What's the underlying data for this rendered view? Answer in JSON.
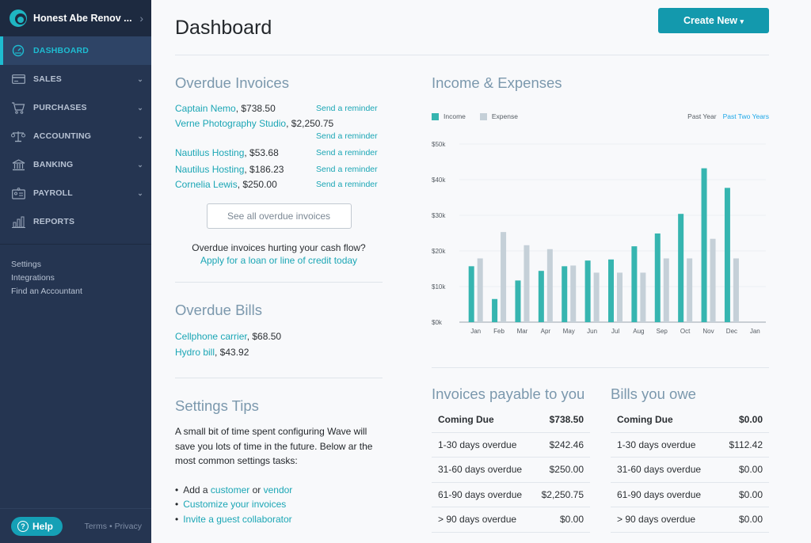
{
  "sidebar": {
    "business_name": "Honest Abe Renov ...",
    "nav": [
      {
        "label": "DASHBOARD",
        "icon": "dashboard-gauge-icon",
        "active": true,
        "expandable": false
      },
      {
        "label": "SALES",
        "icon": "credit-card-icon",
        "active": false,
        "expandable": true
      },
      {
        "label": "PURCHASES",
        "icon": "shopping-cart-icon",
        "active": false,
        "expandable": true
      },
      {
        "label": "ACCOUNTING",
        "icon": "scales-icon",
        "active": false,
        "expandable": true
      },
      {
        "label": "BANKING",
        "icon": "bank-icon",
        "active": false,
        "expandable": true
      },
      {
        "label": "PAYROLL",
        "icon": "id-badge-icon",
        "active": false,
        "expandable": true
      },
      {
        "label": "REPORTS",
        "icon": "bar-chart-icon",
        "active": false,
        "expandable": false
      }
    ],
    "links": [
      "Settings",
      "Integrations",
      "Find an Accountant"
    ],
    "help_label": "Help",
    "terms_label": "Terms",
    "separator": "•",
    "privacy_label": "Privacy"
  },
  "header": {
    "title": "Dashboard",
    "create_label": "Create New",
    "create_caret": "▾"
  },
  "overdue_invoices": {
    "title": "Overdue Invoices",
    "items": [
      {
        "name": "Captain Nemo",
        "amount": ", $738.50",
        "action": "Send a reminder"
      },
      {
        "name": "Verne Photography Studio",
        "amount": ", $2,250.75",
        "action": "Send a reminder"
      },
      {
        "name": "Nautilus Hosting",
        "amount": ", $53.68",
        "action": "Send a reminder"
      },
      {
        "name": "Nautilus Hosting",
        "amount": ", $186.23",
        "action": "Send a reminder"
      },
      {
        "name": "Cornelia Lewis",
        "amount": ", $250.00",
        "action": "Send a reminder"
      }
    ],
    "see_all_label": "See all overdue invoices",
    "cash_flow_text": "Overdue invoices hurting your cash flow?",
    "loan_link": "Apply for a loan or line of credit today"
  },
  "overdue_bills": {
    "title": "Overdue Bills",
    "items": [
      {
        "name": "Cellphone carrier",
        "amount": ", $68.50"
      },
      {
        "name": "Hydro bill",
        "amount": ", $43.92"
      }
    ]
  },
  "settings_tips": {
    "title": "Settings Tips",
    "text": "A small bit of time spent configuring Wave will save you lots of time in the future. Below ar the most common settings tasks:",
    "add_prefix": "Add a ",
    "customer_link": "customer",
    "or_text": " or ",
    "vendor_link": "vendor",
    "customize_link": "Customize your invoices",
    "invite_link": "Invite a guest collaborator"
  },
  "income_expenses": {
    "title": "Income & Expenses",
    "periods": [
      {
        "label": "Past Year",
        "selected": false
      },
      {
        "label": "Past Two Years",
        "selected": true
      }
    ]
  },
  "colors": {
    "income": "#36b5b0",
    "expense": "#c5d0d8",
    "accent": "#1399ad",
    "sidebar": "#253551"
  },
  "chart_data": {
    "type": "bar",
    "title": "Income & Expenses",
    "xlabel": "",
    "ylabel": "",
    "categories": [
      "Jan",
      "Feb",
      "Mar",
      "Apr",
      "May",
      "Jun",
      "Jul",
      "Aug",
      "Sep",
      "Oct",
      "Nov",
      "Dec",
      "Jan"
    ],
    "series": [
      {
        "name": "Income",
        "values": [
          15.7,
          6.5,
          11.7,
          14.4,
          15.7,
          17.3,
          17.6,
          21.3,
          24.9,
          30.4,
          43.2,
          37.7,
          null
        ]
      },
      {
        "name": "Expense",
        "values": [
          17.9,
          25.3,
          21.6,
          20.5,
          15.9,
          13.9,
          13.9,
          13.9,
          17.9,
          17.9,
          23.4,
          17.9,
          null
        ]
      }
    ],
    "units": "thousands USD",
    "ylim": [
      0,
      50
    ],
    "yticks": [
      0,
      10,
      20,
      30,
      40,
      50
    ],
    "ytick_labels": [
      "$0k",
      "$10k",
      "$20k",
      "$30k",
      "$40k",
      "$50k"
    ],
    "grid": true,
    "legend": "top-left"
  },
  "invoices_payable": {
    "title": "Invoices payable to you",
    "rows": [
      {
        "label": "Coming Due",
        "value": "$738.50"
      },
      {
        "label": "1-30 days overdue",
        "value": "$242.46"
      },
      {
        "label": "31-60 days overdue",
        "value": "$250.00"
      },
      {
        "label": "61-90 days overdue",
        "value": "$2,250.75"
      },
      {
        "label": "> 90 days overdue",
        "value": "$0.00"
      }
    ]
  },
  "bills_owe": {
    "title": "Bills you owe",
    "rows": [
      {
        "label": "Coming Due",
        "value": "$0.00"
      },
      {
        "label": "1-30 days overdue",
        "value": "$112.42"
      },
      {
        "label": "31-60 days overdue",
        "value": "$0.00"
      },
      {
        "label": "61-90 days overdue",
        "value": "$0.00"
      },
      {
        "label": "> 90 days overdue",
        "value": "$0.00"
      }
    ]
  }
}
